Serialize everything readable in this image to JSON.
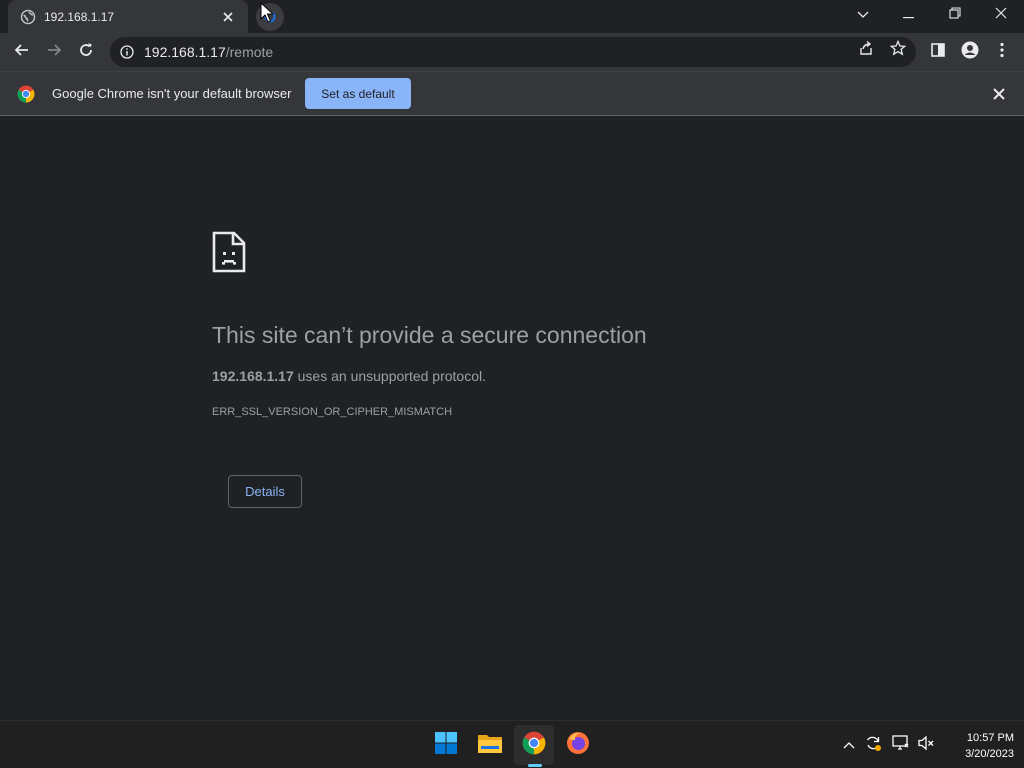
{
  "browser": {
    "tab": {
      "title": "192.168.1.17",
      "icon": "globe-icon"
    },
    "window_controls": [
      "chevron-down-icon",
      "minimize-icon",
      "restore-icon",
      "close-icon"
    ],
    "address": {
      "host": "192.168.1.17",
      "path": "/remote"
    }
  },
  "infobar": {
    "message": "Google Chrome isn't your default browser",
    "button": "Set as default"
  },
  "error_page": {
    "heading": "This site can’t provide a secure connection",
    "host": "192.168.1.17",
    "message": " uses an unsupported protocol.",
    "code": "ERR_SSL_VERSION_OR_CIPHER_MISMATCH",
    "details_button": "Details"
  },
  "taskbar": {
    "apps": [
      "start-icon",
      "file-explorer-icon",
      "chrome-icon",
      "firefox-icon"
    ],
    "active_app": "chrome-icon",
    "tray_icons": [
      "chevron-up-icon",
      "sync-icon",
      "network-icon",
      "volume-muted-icon"
    ],
    "time": "10:57 PM",
    "date": "3/20/2023"
  },
  "colors": {
    "accent": "#8ab4f8",
    "background": "#202124",
    "toolbar": "#35363a",
    "taskbar_indicator": "#60cdff"
  }
}
